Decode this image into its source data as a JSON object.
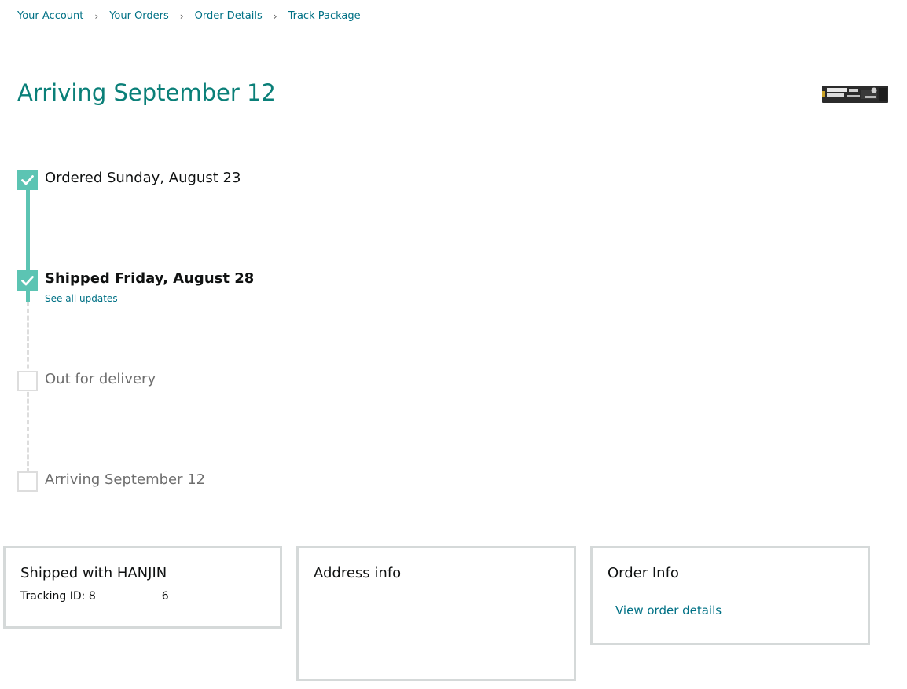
{
  "breadcrumb": {
    "items": [
      "Your Account",
      "Your Orders",
      "Order Details",
      "Track Package"
    ],
    "separator": "›"
  },
  "header": {
    "title": "Arriving September 12",
    "thumbnail": "product-image-ssd"
  },
  "progress": {
    "accent_color": "#5cc4b3",
    "steps": [
      {
        "label": "Ordered Sunday, August 23",
        "status": "complete"
      },
      {
        "label": "Shipped Friday, August 28",
        "status": "complete",
        "link": "See all updates"
      },
      {
        "label": "Out for delivery",
        "status": "pending"
      },
      {
        "label": "Arriving September 12",
        "status": "pending"
      }
    ]
  },
  "cards": {
    "shipping": {
      "title": "Shipped with HANJIN",
      "tracking_label": "Tracking ID:",
      "tracking_start": "8",
      "tracking_end": "6"
    },
    "address": {
      "title": "Address info"
    },
    "order": {
      "title": "Order Info",
      "link": "View order details"
    }
  }
}
